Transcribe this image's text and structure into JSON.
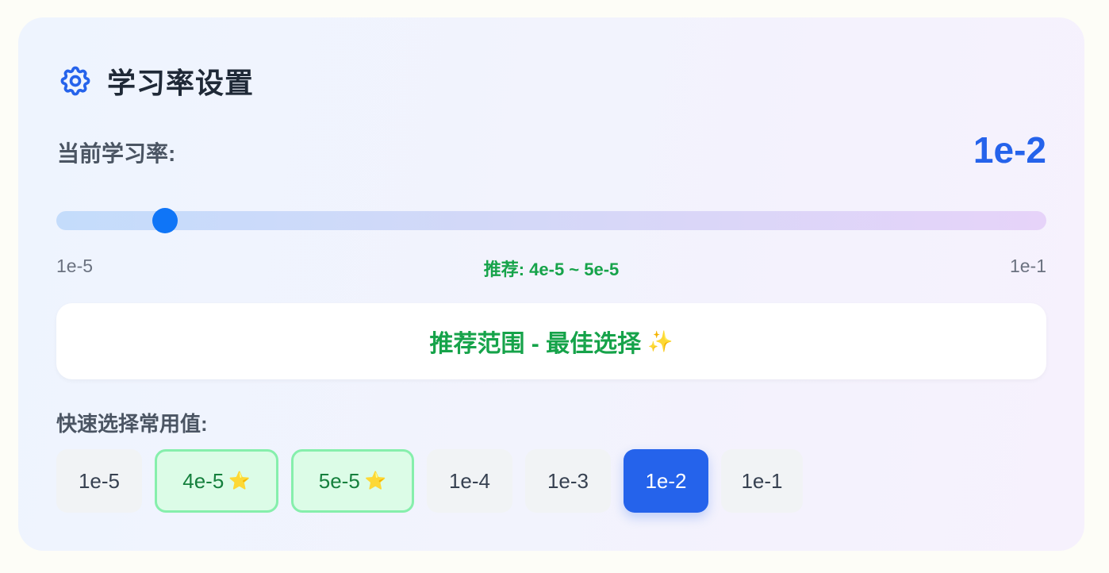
{
  "header": {
    "title": "学习率设置",
    "icon": "gear-icon",
    "icon_color": "#2563eb"
  },
  "current": {
    "label": "当前学习率:",
    "value": "1e-2"
  },
  "slider": {
    "min_label": "1e-5",
    "max_label": "1e-1",
    "recommended_label": "推荐: 4e-5 ~ 5e-5",
    "value": "1e-2",
    "track_gradient_start": "#c4dcfb",
    "track_gradient_end": "#e6d3f9",
    "thumb_color": "#0f75f7"
  },
  "banner": {
    "text": "推荐范围 - 最佳选择",
    "emoji": "✨"
  },
  "quick_select": {
    "label": "快速选择常用值:",
    "star": "⭐",
    "options": [
      {
        "label": "1e-5",
        "state": "plain"
      },
      {
        "label": "4e-5",
        "state": "recommended"
      },
      {
        "label": "5e-5",
        "state": "recommended"
      },
      {
        "label": "1e-4",
        "state": "plain"
      },
      {
        "label": "1e-3",
        "state": "plain"
      },
      {
        "label": "1e-2",
        "state": "active"
      },
      {
        "label": "1e-1",
        "state": "plain"
      }
    ]
  },
  "colors": {
    "accent": "#2563eb",
    "recommended_text": "#16a34a",
    "recommended_bg": "#dcfce7",
    "recommended_border": "#86efac"
  }
}
